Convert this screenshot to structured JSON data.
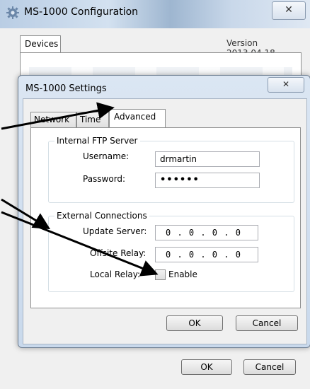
{
  "outer_window": {
    "title": "MS-1000 Configuration",
    "close_glyph": "✕",
    "tab_label": "Devices",
    "version": "Version 2013.04.18",
    "ok_label": "OK",
    "cancel_label": "Cancel"
  },
  "dialog": {
    "title": "MS-1000 Settings",
    "close_glyph": "✕",
    "tabs": [
      {
        "label": "Network"
      },
      {
        "label": "Time"
      },
      {
        "label": "Advanced",
        "active": true
      }
    ],
    "ftp_group": {
      "legend": "Internal FTP Server",
      "username_label": "Username:",
      "username_value": "drmartin",
      "password_label": "Password:",
      "password_value": "••••••"
    },
    "external_group": {
      "legend": "External Connections",
      "update_server_label": "Update Server:",
      "update_server_value": "0 . 0 . 0 . 0",
      "offsite_relay_label": "Offsite Relay:",
      "offsite_relay_value": "0 . 0 . 0 . 0",
      "local_relay_label": "Local Relay:",
      "enable_label": "Enable",
      "enable_checked": false
    },
    "ok_label": "OK",
    "cancel_label": "Cancel"
  },
  "colors": {
    "title_bar": "#c9d8ea",
    "dialog_frame": "#c9d9ec",
    "arrow": "#000000"
  },
  "icons": {
    "app_icon": "gear-icon",
    "close_icon": "close-icon",
    "annotation_arrows": "arrow-icon"
  }
}
